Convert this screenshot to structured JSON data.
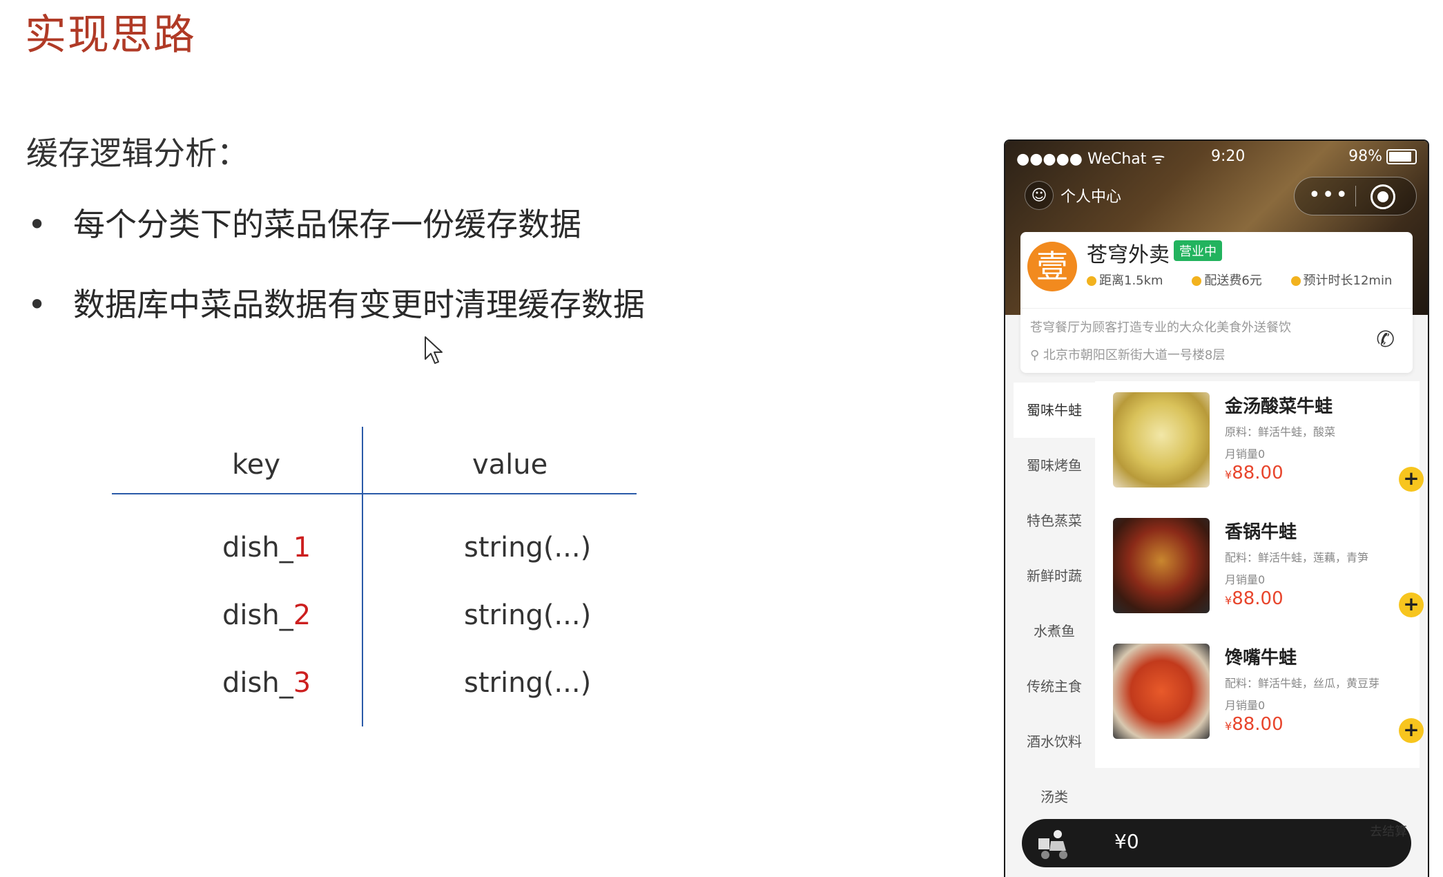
{
  "slide": {
    "title": "实现思路",
    "subtitle": "缓存逻辑分析：",
    "bullets": [
      "每个分类下的菜品保存一份缓存数据",
      "数据库中菜品数据有变更时清理缓存数据"
    ]
  },
  "kv_table": {
    "headers": [
      "key",
      "value"
    ],
    "rows": [
      {
        "key_prefix": "dish_",
        "key_num": "1",
        "value": "string(...)"
      },
      {
        "key_prefix": "dish_",
        "key_num": "2",
        "value": "string(...)"
      },
      {
        "key_prefix": "dish_",
        "key_num": "3",
        "value": "string(...)"
      }
    ]
  },
  "phone": {
    "status": {
      "carrier": "●●●●● WeChat",
      "time": "9:20",
      "battery": "98%"
    },
    "nav": {
      "profile_label": "个人中心"
    },
    "store": {
      "name": "苍穹外卖",
      "badge": "营业中",
      "distance": "距离1.5km",
      "delivery_fee": "配送费6元",
      "eta": "预计时长12min",
      "description": "苍穹餐厅为顾客打造专业的大众化美食外送餐饮",
      "address": "北京市朝阳区新街大道一号楼8层"
    },
    "categories": [
      "蜀味牛蛙",
      "蜀味烤鱼",
      "特色蒸菜",
      "新鲜时蔬",
      "水煮鱼",
      "传统主食",
      "酒水饮料",
      "汤类"
    ],
    "dishes": [
      {
        "name": "金汤酸菜牛蛙",
        "ingredients": "原料：鲜活牛蛙，酸菜",
        "sales": "月销量0",
        "currency": "¥",
        "price": "88.00"
      },
      {
        "name": "香锅牛蛙",
        "ingredients": "配料：鲜活牛蛙，莲藕，青笋",
        "sales": "月销量0",
        "currency": "¥",
        "price": "88.00"
      },
      {
        "name": "馋嘴牛蛙",
        "ingredients": "配料：鲜活牛蛙，丝瓜，黄豆芽",
        "sales": "月销量0",
        "currency": "¥",
        "price": "88.00"
      }
    ],
    "cart": {
      "total": "¥0",
      "checkout": "去结算"
    }
  },
  "colors": {
    "title": "#b03a26",
    "table_line": "#2a5aa8",
    "key_number": "#cc1f1f",
    "price": "#e8452c",
    "open_badge": "#22b35e",
    "add_button": "#f7c51e"
  }
}
